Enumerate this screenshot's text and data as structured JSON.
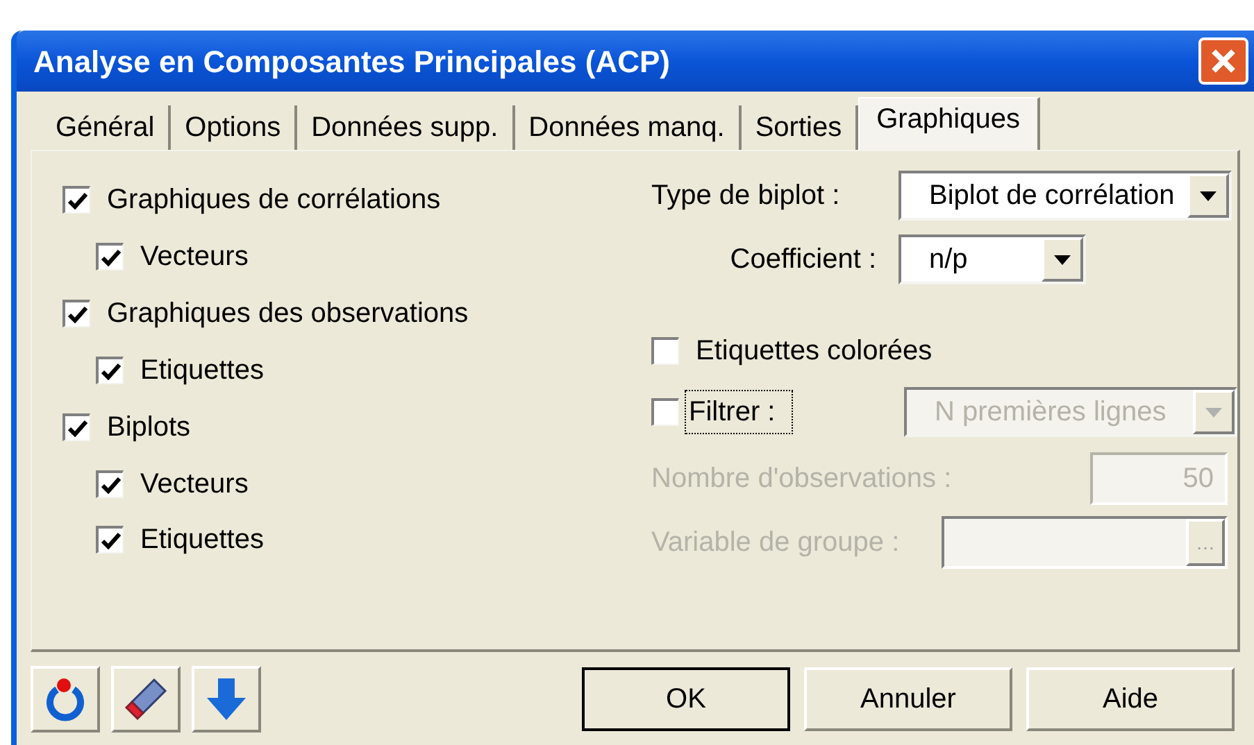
{
  "window": {
    "title": "Analyse en Composantes Principales (ACP)"
  },
  "tabs": [
    {
      "label": "Général",
      "selected": false
    },
    {
      "label": "Options",
      "selected": false
    },
    {
      "label": "Données supp.",
      "selected": false
    },
    {
      "label": "Données manq.",
      "selected": false
    },
    {
      "label": "Sorties",
      "selected": false
    },
    {
      "label": "Graphiques",
      "selected": true
    }
  ],
  "charts_options": [
    {
      "label": "Graphiques de corrélations",
      "checked": true,
      "children": [
        {
          "label": "Vecteurs",
          "checked": true
        }
      ]
    },
    {
      "label": "Graphiques des observations",
      "checked": true,
      "children": [
        {
          "label": "Etiquettes",
          "checked": true
        }
      ]
    },
    {
      "label": "Biplots",
      "checked": true,
      "children": [
        {
          "label": "Vecteurs",
          "checked": true
        },
        {
          "label": "Etiquettes",
          "checked": true
        }
      ]
    }
  ],
  "biplot_type": {
    "label": "Type de biplot :",
    "value": "Biplot de corrélation",
    "disabled": false
  },
  "coefficient": {
    "label": "Coefficient :",
    "value": "n/p",
    "disabled": false
  },
  "colored_labels": {
    "label": "Etiquettes colorées",
    "checked": false
  },
  "filter": {
    "label": "Filtrer :",
    "checked": false,
    "focused": true,
    "select": {
      "value": "N premières lignes",
      "disabled": true
    }
  },
  "observations": {
    "label": "Nombre d'observations :",
    "value": "50",
    "disabled": true
  },
  "group_variable": {
    "label": "Variable de groupe :",
    "button": "…",
    "disabled": true
  },
  "buttons": [
    {
      "label": "OK",
      "default": true
    },
    {
      "label": "Annuler",
      "default": false
    },
    {
      "label": "Aide",
      "default": false
    }
  ]
}
